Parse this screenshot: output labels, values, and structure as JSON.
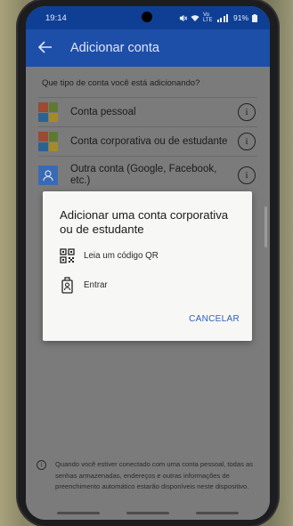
{
  "status": {
    "time": "19:14",
    "icons": [
      "mute-icon",
      "wifi-icon",
      "signal-icon",
      "battery-icon"
    ],
    "network": "Vo LTE",
    "battery": "91%"
  },
  "appbar": {
    "title": "Adicionar conta",
    "back_icon": "arrow-left-icon"
  },
  "content": {
    "question": "Que tipo de conta você está adicionando?",
    "options": [
      {
        "label": "Conta pessoal",
        "icon": "microsoft-logo-icon"
      },
      {
        "label": "Conta corporativa ou de estudante",
        "icon": "microsoft-logo-icon"
      },
      {
        "label": "Outra conta (Google, Facebook, etc.)",
        "icon": "person-icon"
      }
    ],
    "info_glyph": "i",
    "footer_text": "Quando você estiver conectado com uma conta pessoal, todas as senhas armazenadas, endereços e outras informações de preenchimento automático estarão disponíveis neste dispositivo."
  },
  "dialog": {
    "title": "Adicionar uma conta corporativa ou de estudante",
    "options": [
      {
        "label": "Leia um código QR",
        "icon": "qr-code-icon"
      },
      {
        "label": "Entrar",
        "icon": "id-badge-icon"
      }
    ],
    "cancel_label": "CANCELAR"
  },
  "colors": {
    "accent": "#2b5fb8",
    "appbar": "#1e4fa8",
    "statusbar": "#0f3f95"
  }
}
